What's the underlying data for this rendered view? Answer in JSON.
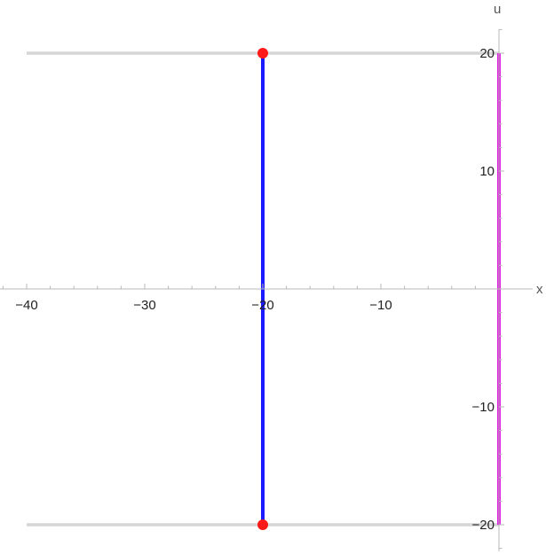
{
  "chart_data": {
    "type": "line",
    "title": "",
    "xlabel": "x",
    "ylabel": "u",
    "xlim": [
      -42,
      0.5
    ],
    "ylim": [
      -21.5,
      21.5
    ],
    "grid": false,
    "x_ticks": [
      -40,
      -30,
      -20,
      -10
    ],
    "x_tick_labels": [
      "−40",
      "−30",
      "−20",
      "−10"
    ],
    "y_ticks": [
      -20,
      -10,
      10,
      20
    ],
    "y_tick_labels": [
      "−20",
      "−10",
      "10",
      "20"
    ],
    "series": [
      {
        "style": "gray-line",
        "color": "#d6d6d6",
        "x": [
          -40,
          0
        ],
        "y": [
          20,
          20
        ]
      },
      {
        "style": "gray-line",
        "color": "#d6d6d6",
        "x": [
          -40,
          0
        ],
        "y": [
          -20,
          -20
        ]
      },
      {
        "style": "blue-line",
        "color": "#1a1aff",
        "x": [
          -20,
          -20
        ],
        "y": [
          -20,
          20
        ]
      },
      {
        "style": "magenta-line",
        "color": "#e020e0",
        "x": [
          0,
          0
        ],
        "y": [
          -20,
          20
        ]
      },
      {
        "style": "red-points",
        "color": "#ff1a1a",
        "x": [
          -20,
          -20
        ],
        "y": [
          20,
          -20
        ]
      }
    ]
  }
}
